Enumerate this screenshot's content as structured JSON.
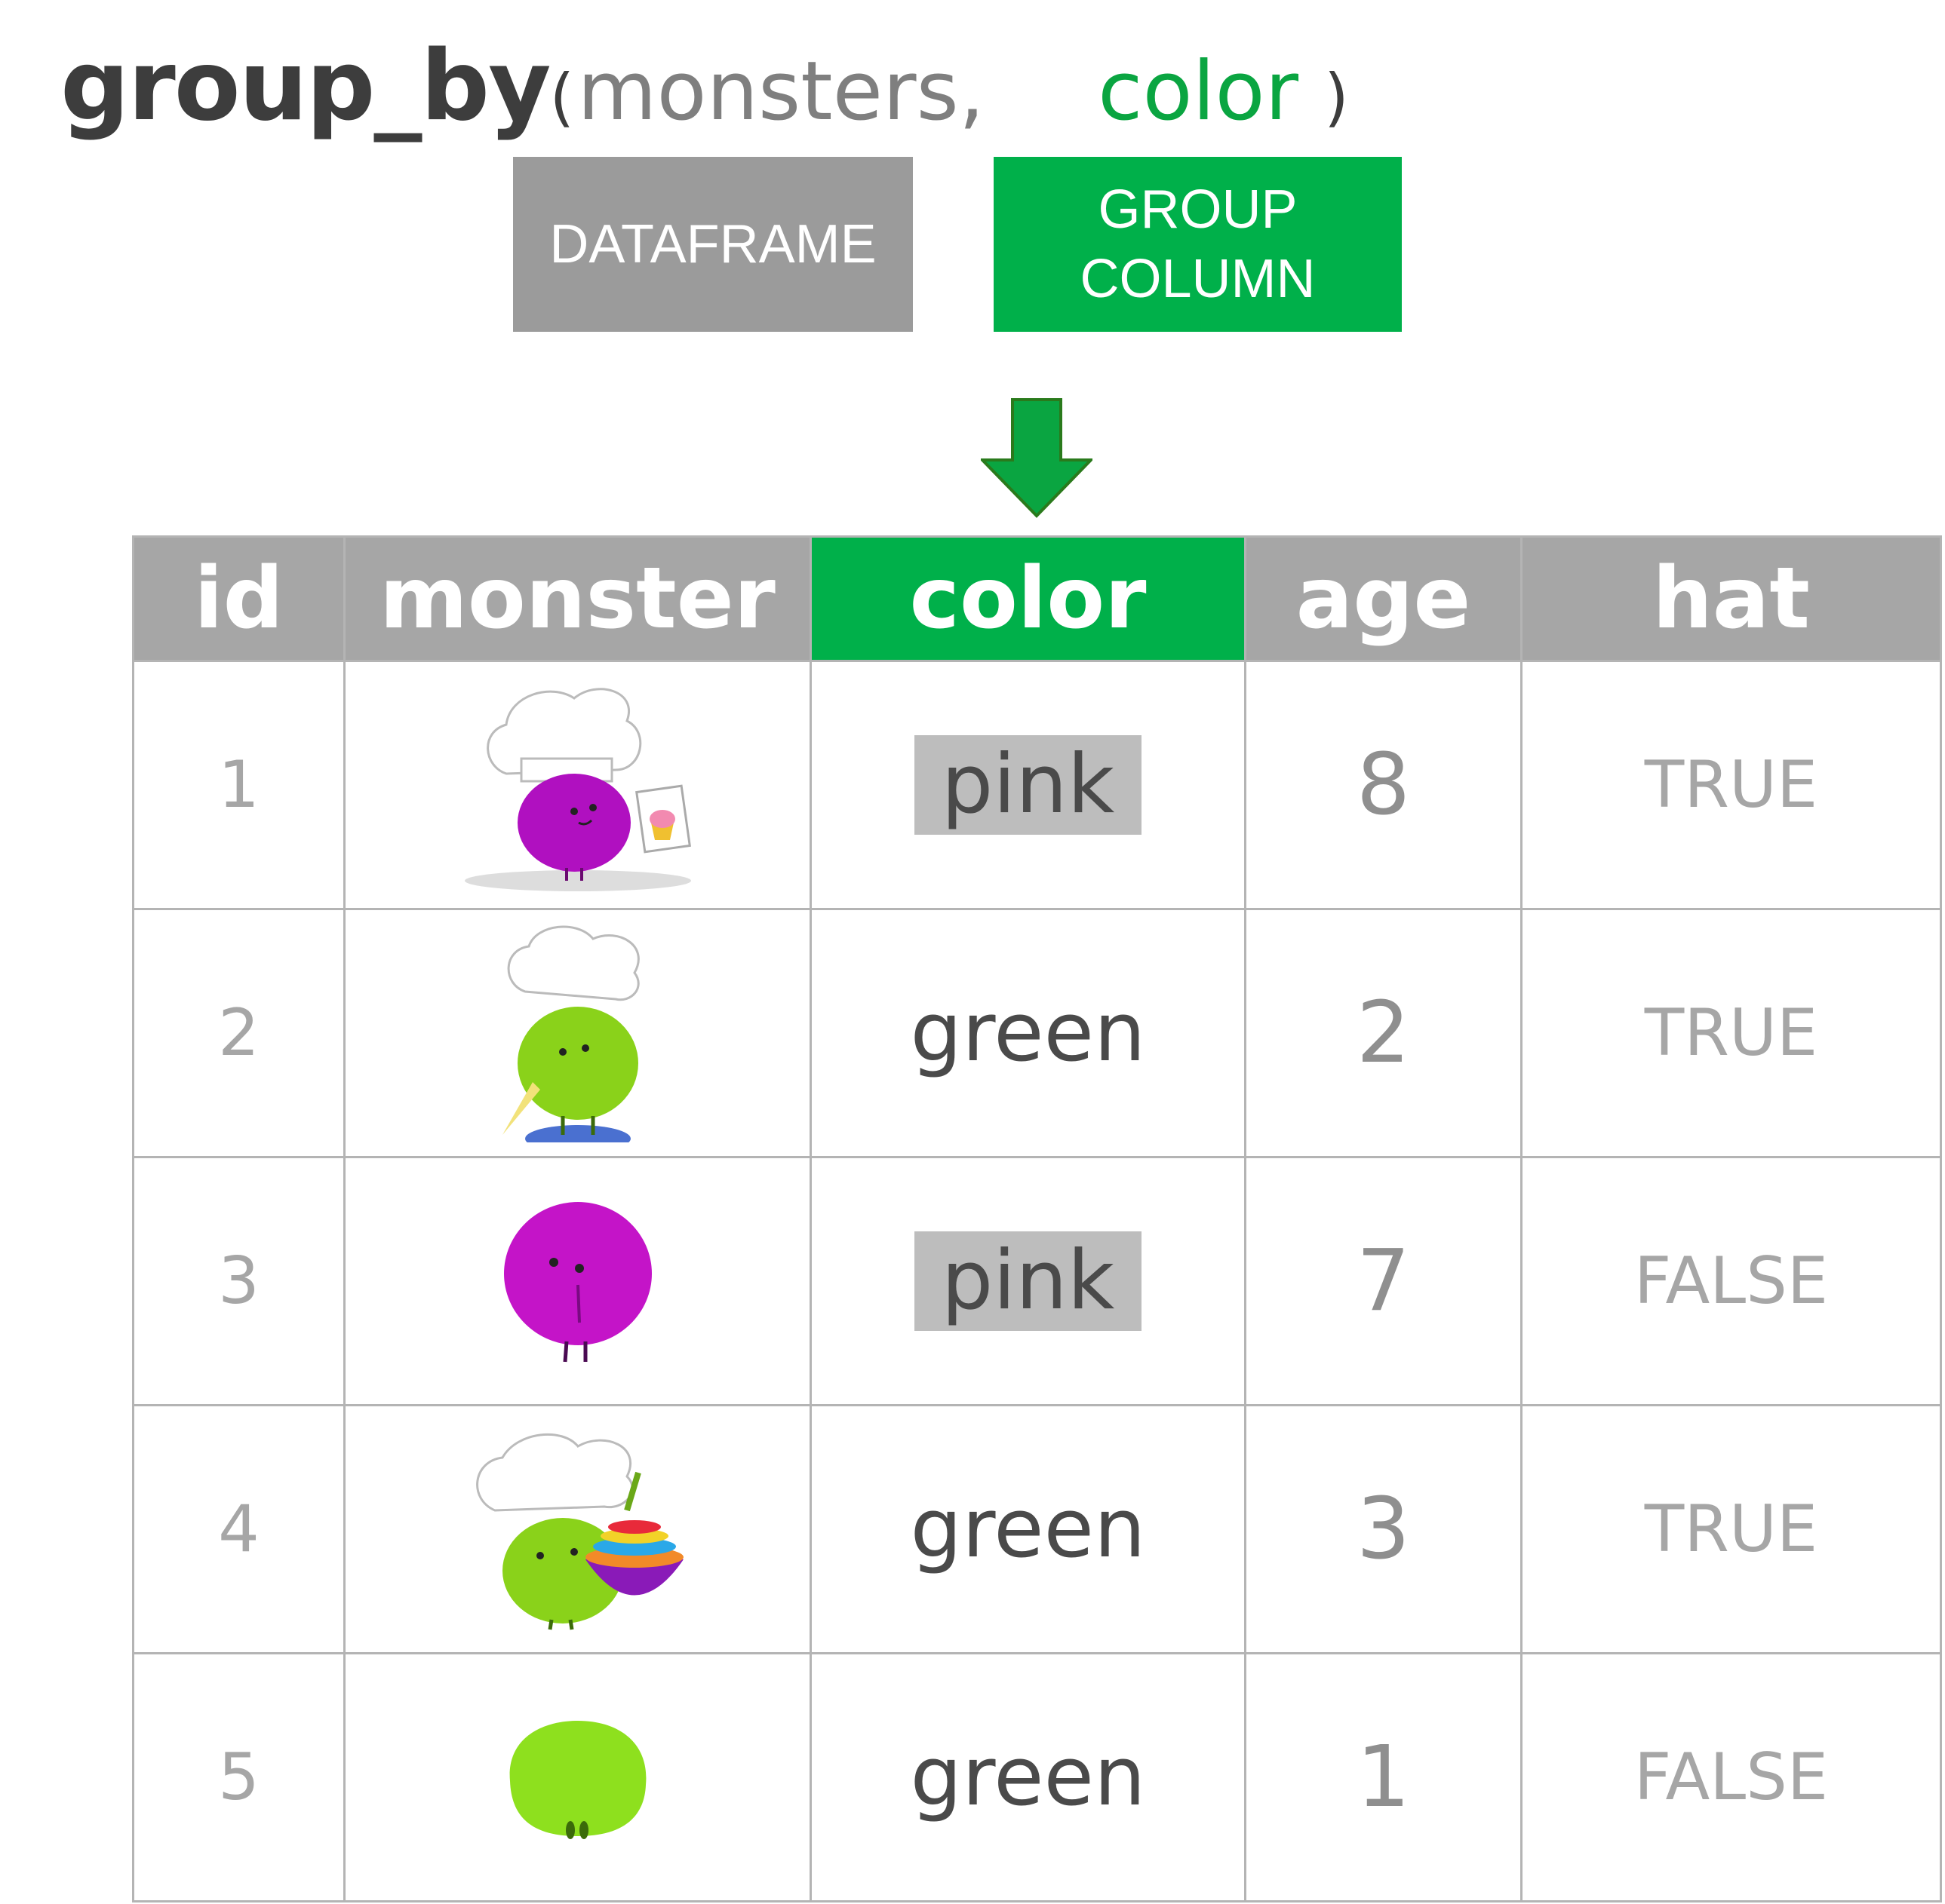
{
  "code": {
    "function": "group_by",
    "open_paren": "(",
    "arg_dataframe": "monsters,",
    "arg_group": "color",
    "close_paren": ")"
  },
  "labels": {
    "dataframe": "DATAFRAME",
    "group_column_line1": "GROUP",
    "group_column_line2": "COLUMN"
  },
  "colors": {
    "group_green": "#00b04a",
    "dataframe_gray": "#9b9b9b",
    "highlight_gray": "#bdbdbd"
  },
  "table": {
    "headers": [
      "id",
      "monster",
      "color",
      "age",
      "hat"
    ],
    "selected_column": "color",
    "rows": [
      {
        "id": "1",
        "monster": "pink-monster-chef-cupcake",
        "color": "pink",
        "age": "8",
        "hat": "TRUE",
        "highlight": true
      },
      {
        "id": "2",
        "monster": "green-monster-chef",
        "color": "green",
        "age": "2",
        "hat": "TRUE",
        "highlight": false
      },
      {
        "id": "3",
        "monster": "pink-monster",
        "color": "pink",
        "age": "7",
        "hat": "FALSE",
        "highlight": true
      },
      {
        "id": "4",
        "monster": "green-monster-chef-bowls",
        "color": "green",
        "age": "3",
        "hat": "TRUE",
        "highlight": false
      },
      {
        "id": "5",
        "monster": "green-monster",
        "color": "green",
        "age": "1",
        "hat": "FALSE",
        "highlight": false
      }
    ]
  }
}
